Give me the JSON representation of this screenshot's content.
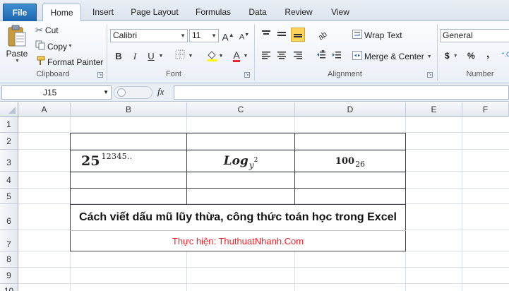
{
  "tabs": {
    "file": "File",
    "items": [
      "Home",
      "Insert",
      "Page Layout",
      "Formulas",
      "Data",
      "Review",
      "View"
    ],
    "active": "Home"
  },
  "ribbon": {
    "clipboard": {
      "label": "Clipboard",
      "paste": "Paste",
      "cut": "Cut",
      "copy": "Copy",
      "format_painter": "Format Painter"
    },
    "font": {
      "label": "Font",
      "font_name": "Calibri",
      "font_size": "11",
      "bold": "B",
      "italic": "I",
      "underline": "U",
      "grow": "A",
      "shrink": "A",
      "font_color": "A"
    },
    "alignment": {
      "label": "Alignment",
      "wrap_text": "Wrap Text",
      "merge_center": "Merge & Center"
    },
    "number": {
      "label": "Number",
      "format": "General",
      "currency": "$",
      "percent": "%",
      "comma": ","
    }
  },
  "formula_bar": {
    "name_box": "J15",
    "fx": "fx",
    "value": ""
  },
  "sheet": {
    "columns": [
      "A",
      "B",
      "C",
      "D",
      "E",
      "F"
    ],
    "rows": [
      "1",
      "2",
      "3",
      "4",
      "5",
      "6",
      "7",
      "8",
      "9",
      "10"
    ],
    "cells": {
      "b3_base": "25",
      "b3_sup": "12345..",
      "c3_base": "Log",
      "c3_sub": "y",
      "c3_sup": "2",
      "d3_base": "100",
      "d3_sub": "26",
      "title": "Cách viết dấu mũ lũy thừa, công thức toán học  trong Excel",
      "credit": "Thực hiện: ThuthuatNhanh.Com"
    }
  },
  "colors": {
    "accent": "#1e64ae",
    "credit": "#e8262d",
    "grid": "#dadfe6"
  }
}
